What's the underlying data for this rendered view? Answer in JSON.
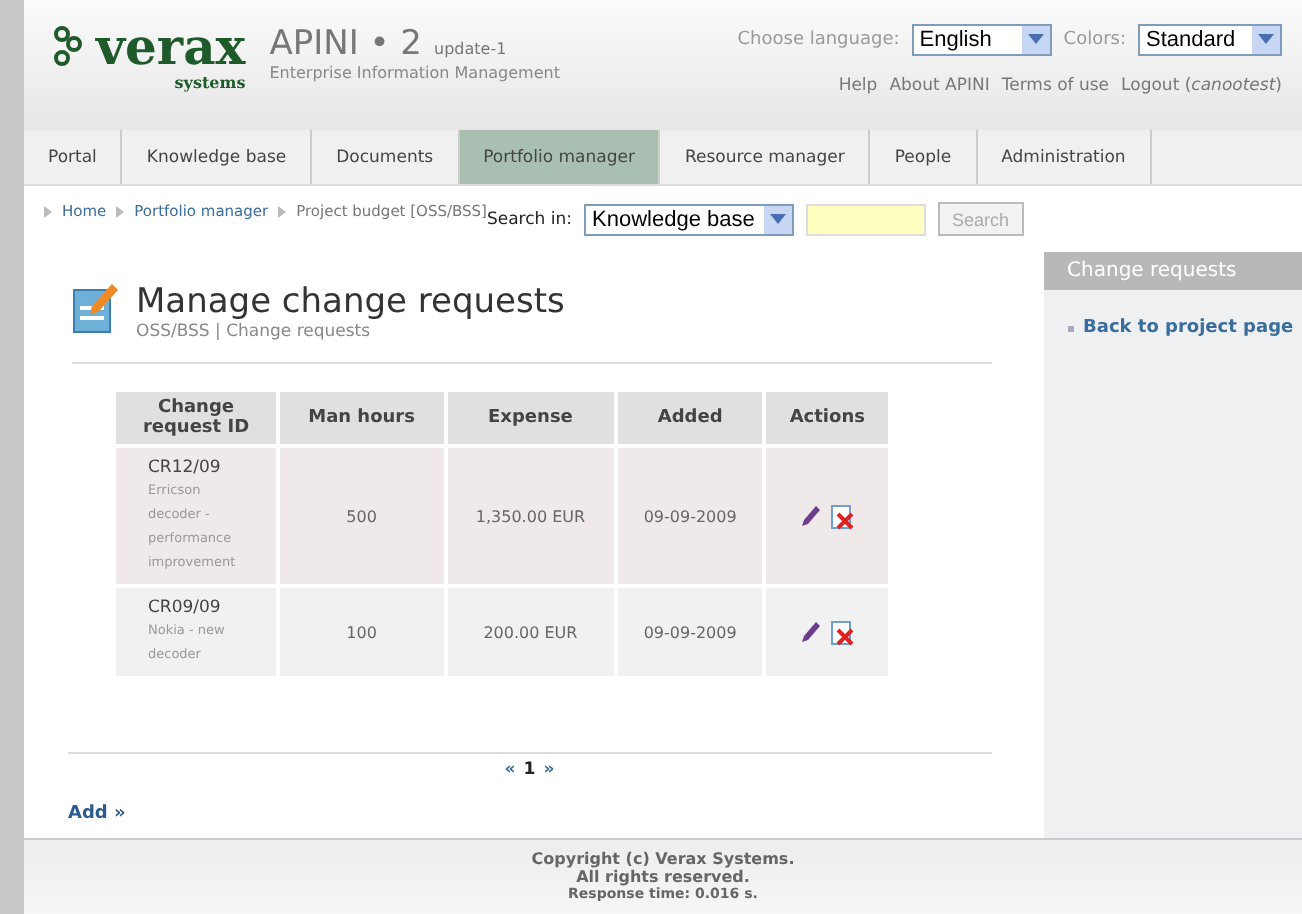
{
  "header": {
    "logo": "verax",
    "logo_sub": "systems",
    "product": "APINI • 2",
    "version": "update-1",
    "tagline": "Enterprise Information Management",
    "language_label": "Choose language:",
    "language": "English",
    "colors_label": "Colors:",
    "colors": "Standard",
    "links": [
      "Help",
      "About APINI",
      "Terms of use",
      "Logout (*canootest*)"
    ]
  },
  "tabs": [
    {
      "label": "Portal",
      "selected": false
    },
    {
      "label": "Knowledge base",
      "selected": false
    },
    {
      "label": "Documents",
      "selected": false
    },
    {
      "label": "Portfolio manager",
      "selected": true
    },
    {
      "label": "Resource manager",
      "selected": false
    },
    {
      "label": "People",
      "selected": false
    },
    {
      "label": "Administration",
      "selected": false
    }
  ],
  "breadcrumb": [
    {
      "label": "Home",
      "link": true
    },
    {
      "label": "Portfolio manager",
      "link": true
    },
    {
      "label": "Project budget [OSS/BSS]",
      "link": false
    }
  ],
  "search": {
    "label": "Search in:",
    "scope": "Knowledge base",
    "button": "Search"
  },
  "page": {
    "title": "Manage change requests",
    "subtitle": "OSS/BSS | Change requests"
  },
  "table": {
    "columns": [
      "Change request ID",
      "Man hours",
      "Expense",
      "Added",
      "Actions"
    ],
    "rows": [
      {
        "id": "CR12/09",
        "description": "Erricson decoder - performance improvement",
        "hours": "500",
        "expense": "1,350.00 EUR",
        "added": "09-09-2009"
      },
      {
        "id": "CR09/09",
        "description": "Nokia - new decoder",
        "hours": "100",
        "expense": "200.00 EUR",
        "added": "09-09-2009"
      }
    ]
  },
  "pagination": {
    "prev": "«",
    "page": "1",
    "next": "»"
  },
  "add_link": "Add »",
  "sidebar": {
    "title": "Change requests",
    "links": [
      "Back to project page"
    ]
  },
  "footer": [
    "Copyright (c) Verax Systems.",
    "All rights reserved.",
    "Response time: 0.016 s."
  ]
}
